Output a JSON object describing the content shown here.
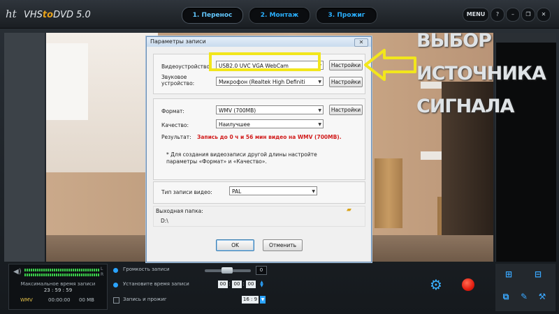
{
  "app": {
    "logo_ht": "ht",
    "logo_vhs": "VHS",
    "logo_to": "to",
    "logo_dvd": "DVD 5.0"
  },
  "steps": [
    {
      "label": "1. Перенос"
    },
    {
      "label": "2. Монтаж"
    },
    {
      "label": "3. Прожиг"
    }
  ],
  "window_buttons": {
    "menu": "MENU",
    "help": "?",
    "minimize": "–",
    "maximize": "❐",
    "close": "✕"
  },
  "dialog": {
    "title": "Параметры записи",
    "close": "✕",
    "video_device_label": "Видеоустройство:",
    "video_device_value": "USB2.0 UVC VGA WebCam",
    "settings_btn": "Настройки",
    "audio_device_label_1": "Звуковое",
    "audio_device_label_2": "устройство:",
    "audio_device_value": "Микрофон (Realtek High Definiti",
    "format_label": "Формат:",
    "format_value": "WMV (700MB)",
    "quality_label": "Качество:",
    "quality_value": "Наилучшее",
    "result_label": "Результат:",
    "result_value": "Запись до 0 ч и 56 мин видео на WMV (700MB).",
    "note": "* Для создания видеозаписи другой длины настройте параметры «Формат» и «Качество».",
    "video_type_label": "Тип записи видео:",
    "video_type_value": "PAL",
    "output_folder_label": "Выходная папка:",
    "output_folder_value": "D:\\",
    "ok": "OK",
    "cancel": "Отменить"
  },
  "overlay": {
    "line1": "ВЫБОР",
    "line2": "ИСТОЧНИКА",
    "line3": "СИГНАЛА"
  },
  "audio_panel": {
    "chan_l": "L",
    "chan_r": "R",
    "max_record_label": "Максимальное время записи",
    "max_record_value": "23 : 59 : 59",
    "format": "WMV",
    "elapsed": "00:00:00",
    "size": "00 MB"
  },
  "settings": {
    "volume_label": "Громкость записи",
    "volume_value": "0",
    "set_time_label": "Установите время записи",
    "time_h": "00",
    "time_m": "00",
    "time_s": "00",
    "burn_label": "Запись и прожиг",
    "ratio": "16 : 9"
  },
  "colors": {
    "accent": "#2aa3ff",
    "highlight": "#f2e61c",
    "record": "#e21d10",
    "result_text": "#d11b1b"
  },
  "icons": [
    "speaker-icon",
    "gear-icon",
    "record-icon",
    "folder-icon",
    "arrow-left-icon",
    "spin-icon",
    "dropdown-icon"
  ]
}
